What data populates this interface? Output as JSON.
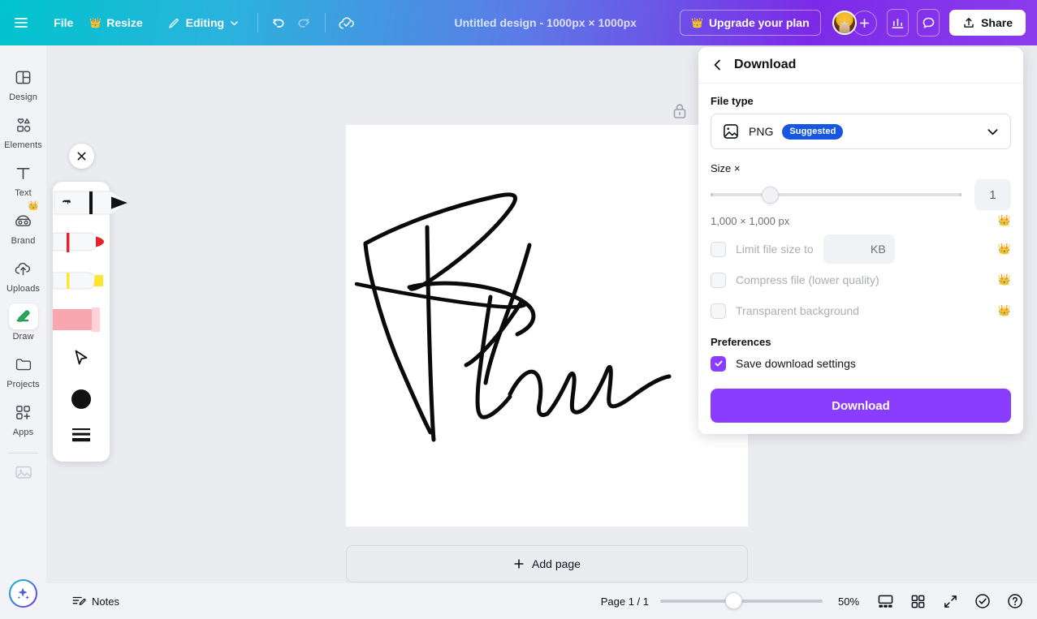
{
  "header": {
    "menu_icon": "hamburger-menu-icon",
    "file_label": "File",
    "resize_label": "Resize",
    "editing_label": "Editing",
    "undo_icon": "undo-icon",
    "redo_icon": "redo-icon",
    "cloud_saved_icon": "cloud-check-icon",
    "doc_title": "Untitled design - 1000px × 1000px",
    "upgrade_label": "Upgrade your plan",
    "add_member_icon": "plus-icon",
    "insights_icon": "bar-chart-icon",
    "comments_icon": "comment-icon",
    "share_label": "Share",
    "share_icon": "upload-icon",
    "gradient_start": "#00c4cc",
    "gradient_end": "#8b3ced"
  },
  "sidebar": {
    "items": [
      {
        "label": "Design",
        "icon": "layout-panels-icon",
        "active": false,
        "pro": false
      },
      {
        "label": "Elements",
        "icon": "shapes-icon",
        "active": false,
        "pro": false
      },
      {
        "label": "Text",
        "icon": "text-t-icon",
        "active": false,
        "pro": false
      },
      {
        "label": "Brand",
        "icon": "brand-kit-icon",
        "active": false,
        "pro": true
      },
      {
        "label": "Uploads",
        "icon": "cloud-upload-icon",
        "active": false,
        "pro": false
      },
      {
        "label": "Draw",
        "icon": "draw-pen-icon",
        "active": true,
        "pro": false
      },
      {
        "label": "Projects",
        "icon": "folder-icon",
        "active": false,
        "pro": false
      },
      {
        "label": "Apps",
        "icon": "apps-grid-icon",
        "active": false,
        "pro": false
      }
    ],
    "image_placeholder_icon": "image-placeholder-icon",
    "magic_icon": "magic-sparkle-icon"
  },
  "draw_popup": {
    "close_icon": "close-x-icon",
    "tools": [
      {
        "name": "pen-tool",
        "selected": true,
        "color": "#121212"
      },
      {
        "name": "marker-tool",
        "selected": false,
        "color": "#e5212a"
      },
      {
        "name": "highlighter-tool",
        "selected": false,
        "color": "#ffe62e"
      },
      {
        "name": "eraser-tool",
        "selected": false,
        "color": "#f7a2ac"
      },
      {
        "name": "select-cursor-tool",
        "icon": "cursor-arrow-icon"
      },
      {
        "name": "color-swatch",
        "icon": "color-circle-icon",
        "color": "#121212"
      },
      {
        "name": "stroke-size",
        "icon": "stroke-weight-icon"
      }
    ]
  },
  "canvas": {
    "lock_icon": "lock-icon",
    "artwork_alt": "handwritten-signature",
    "add_page_label": "Add page",
    "add_page_icon": "plus-icon"
  },
  "download": {
    "back_icon": "chevron-left-icon",
    "title": "Download",
    "file_type_label": "File type",
    "file_type_value": "PNG",
    "file_type_icon": "image-file-icon",
    "suggested_badge": "Suggested",
    "chevron_icon": "chevron-down-icon",
    "size_label": "Size ×",
    "size_value": "1",
    "dimensions": "1,000 × 1,000 px",
    "options": [
      {
        "label": "Limit file size to",
        "checked": false,
        "pro": true,
        "field_suffix": "KB",
        "field_value": ""
      },
      {
        "label": "Compress file (lower quality)",
        "checked": false,
        "pro": true
      },
      {
        "label": "Transparent background",
        "checked": false,
        "pro": true
      }
    ],
    "preferences_label": "Preferences",
    "save_settings_label": "Save download settings",
    "save_settings_checked": true,
    "download_button_label": "Download",
    "accent_color": "#8b3dff",
    "badge_color": "#1756e0"
  },
  "bottombar": {
    "notes_label": "Notes",
    "notes_icon": "notes-pencil-icon",
    "page_indicator": "Page 1 / 1",
    "zoom_value": "50%",
    "grid_view_icon": "page-view-icon",
    "grid_icon": "grid-view-icon",
    "fullscreen_icon": "expand-arrows-icon",
    "check_icon": "check-circle-icon",
    "help_icon": "help-question-icon"
  }
}
